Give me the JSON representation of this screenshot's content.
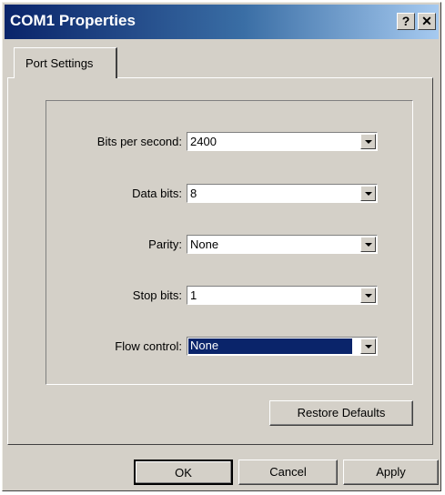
{
  "window": {
    "title": "COM1 Properties"
  },
  "titlebar_buttons": {
    "help": "?",
    "close": "✕"
  },
  "tab": {
    "label": "Port Settings"
  },
  "fields": [
    {
      "label": "Bits per second:",
      "value": "2400",
      "selected": false
    },
    {
      "label": "Data bits:",
      "value": "8",
      "selected": false
    },
    {
      "label": "Parity:",
      "value": "None",
      "selected": false
    },
    {
      "label": "Stop bits:",
      "value": "1",
      "selected": false
    },
    {
      "label": "Flow control:",
      "value": "None",
      "selected": true
    }
  ],
  "buttons": {
    "restore": "Restore Defaults",
    "ok": "OK",
    "cancel": "Cancel",
    "apply": "Apply"
  },
  "colors": {
    "title_gradient_start": "#0a246a",
    "title_gradient_end": "#a6caf0",
    "face": "#d4d0c8",
    "selection": "#0a246a"
  }
}
